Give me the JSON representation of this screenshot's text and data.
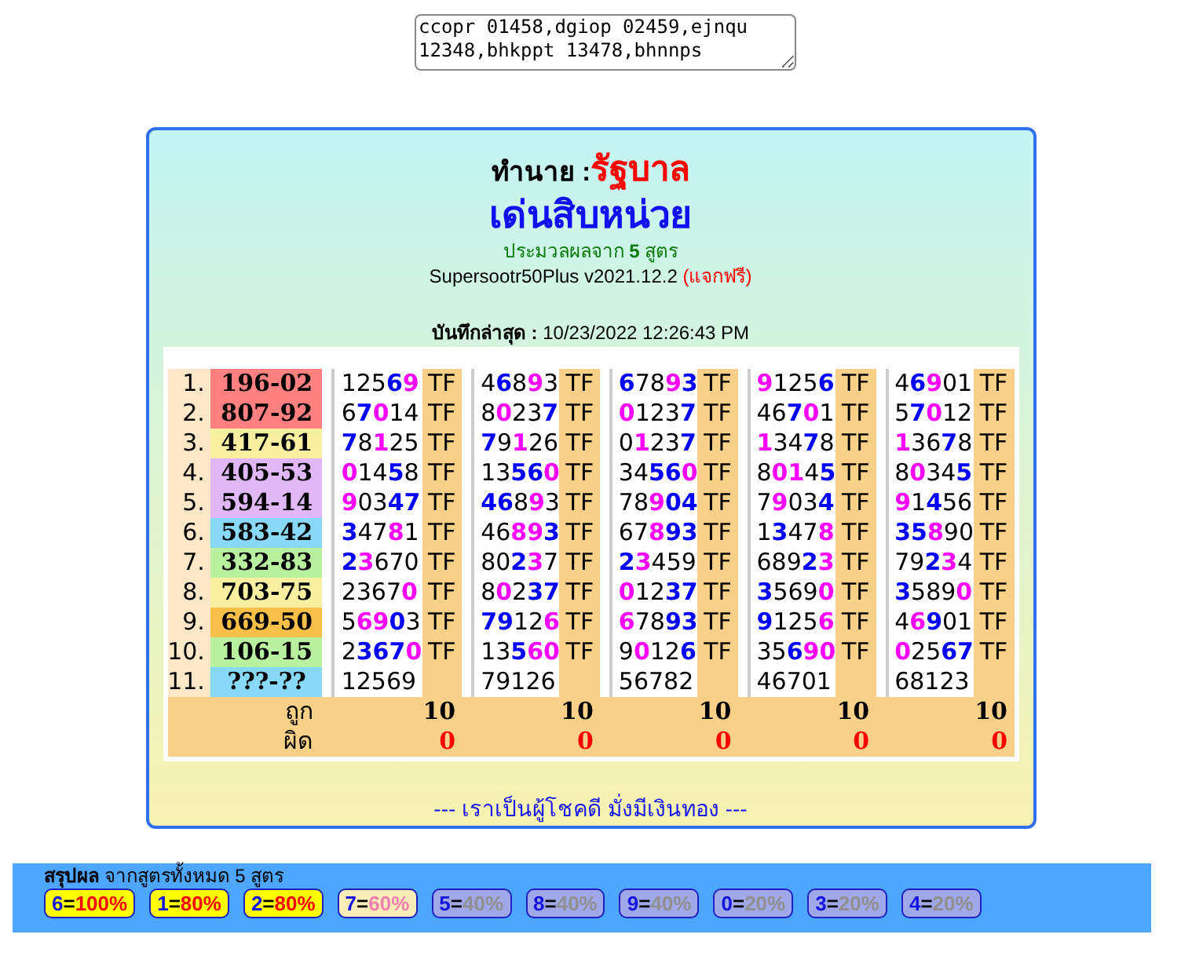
{
  "input_box": {
    "value": "ccopr 01458,dgiop 02459,ejnqu 12348,bhkppt 13478,bhnnps"
  },
  "header": {
    "predict_label": "ทำนาย : ",
    "predict_value": "รัฐบาล",
    "title": "เด่นสิบหน่วย",
    "subtitle": "ประมวลผลจาก **5** สูตร",
    "version": "Supersootr50Plus v2021.12.2 ",
    "free_tag": "(แจกฟรี)",
    "saved": "**บันทึกล่าสุด :** 10/23/2022 12:26:43 PM"
  },
  "table": {
    "rows": [
      {
        "index": "1.",
        "result": "196-02",
        "color": "#ff8080",
        "cells": [
          {
            "parts": [
              {
                "text": "125",
                "color": "#000000"
              },
              {
                "text": "6",
                "color": "#0000ff"
              },
              {
                "text": "9",
                "color": "#ff00ff"
              }
            ],
            "tag": "TF"
          },
          {
            "parts": [
              {
                "text": "4",
                "color": "#000000"
              },
              {
                "text": "6",
                "color": "#0000ff"
              },
              {
                "text": "8",
                "color": "#000000"
              },
              {
                "text": "9",
                "color": "#ff00ff"
              },
              {
                "text": "3",
                "color": "#000000"
              }
            ],
            "tag": "TF"
          },
          {
            "parts": [
              {
                "text": "6",
                "color": "#0000ff"
              },
              {
                "text": "78",
                "color": "#000000"
              },
              {
                "text": "9",
                "color": "#ff00ff"
              },
              {
                "text": "3",
                "color": "#0000ff"
              }
            ],
            "tag": "TF"
          },
          {
            "parts": [
              {
                "text": "9",
                "color": "#ff00ff"
              },
              {
                "text": "125",
                "color": "#000000"
              },
              {
                "text": "6",
                "color": "#0000ff"
              }
            ],
            "tag": "TF"
          },
          {
            "parts": [
              {
                "text": "4",
                "color": "#000000"
              },
              {
                "text": "6",
                "color": "#0000ff"
              },
              {
                "text": "9",
                "color": "#ff00ff"
              },
              {
                "text": "01",
                "color": "#000000"
              }
            ],
            "tag": "TF"
          }
        ]
      },
      {
        "index": "2.",
        "result": "807-92",
        "color": "#ff8080",
        "cells": [
          {
            "parts": [
              {
                "text": "6",
                "color": "#000000"
              },
              {
                "text": "7",
                "color": "#0000ff"
              },
              {
                "text": "0",
                "color": "#ff00ff"
              },
              {
                "text": "14",
                "color": "#000000"
              }
            ],
            "tag": "TF"
          },
          {
            "parts": [
              {
                "text": "8",
                "color": "#000000"
              },
              {
                "text": "0",
                "color": "#ff00ff"
              },
              {
                "text": "23",
                "color": "#000000"
              },
              {
                "text": "7",
                "color": "#0000ff"
              }
            ],
            "tag": "TF"
          },
          {
            "parts": [
              {
                "text": "0",
                "color": "#ff00ff"
              },
              {
                "text": "123",
                "color": "#000000"
              },
              {
                "text": "7",
                "color": "#0000ff"
              }
            ],
            "tag": "TF"
          },
          {
            "parts": [
              {
                "text": "46",
                "color": "#000000"
              },
              {
                "text": "7",
                "color": "#0000ff"
              },
              {
                "text": "0",
                "color": "#ff00ff"
              },
              {
                "text": "1",
                "color": "#000000"
              }
            ],
            "tag": "TF"
          },
          {
            "parts": [
              {
                "text": "5",
                "color": "#000000"
              },
              {
                "text": "7",
                "color": "#0000ff"
              },
              {
                "text": "0",
                "color": "#ff00ff"
              },
              {
                "text": "12",
                "color": "#000000"
              }
            ],
            "tag": "TF"
          }
        ]
      },
      {
        "index": "3.",
        "result": "417-61",
        "color": "#f8f0a0",
        "cells": [
          {
            "parts": [
              {
                "text": "7",
                "color": "#0000ff"
              },
              {
                "text": "8",
                "color": "#000000"
              },
              {
                "text": "1",
                "color": "#ff00ff"
              },
              {
                "text": "25",
                "color": "#000000"
              }
            ],
            "tag": "TF"
          },
          {
            "parts": [
              {
                "text": "7",
                "color": "#0000ff"
              },
              {
                "text": "9",
                "color": "#000000"
              },
              {
                "text": "1",
                "color": "#ff00ff"
              },
              {
                "text": "26",
                "color": "#000000"
              }
            ],
            "tag": "TF"
          },
          {
            "parts": [
              {
                "text": "0",
                "color": "#000000"
              },
              {
                "text": "1",
                "color": "#ff00ff"
              },
              {
                "text": "23",
                "color": "#000000"
              },
              {
                "text": "7",
                "color": "#0000ff"
              }
            ],
            "tag": "TF"
          },
          {
            "parts": [
              {
                "text": "1",
                "color": "#ff00ff"
              },
              {
                "text": "34",
                "color": "#000000"
              },
              {
                "text": "7",
                "color": "#0000ff"
              },
              {
                "text": "8",
                "color": "#000000"
              }
            ],
            "tag": "TF"
          },
          {
            "parts": [
              {
                "text": "1",
                "color": "#ff00ff"
              },
              {
                "text": "36",
                "color": "#000000"
              },
              {
                "text": "7",
                "color": "#0000ff"
              },
              {
                "text": "8",
                "color": "#000000"
              }
            ],
            "tag": "TF"
          }
        ]
      },
      {
        "index": "4.",
        "result": "405-53",
        "color": "#e0b8f8",
        "cells": [
          {
            "parts": [
              {
                "text": "0",
                "color": "#ff00ff"
              },
              {
                "text": "14",
                "color": "#000000"
              },
              {
                "text": "5",
                "color": "#0000ff"
              },
              {
                "text": "8",
                "color": "#000000"
              }
            ],
            "tag": "TF"
          },
          {
            "parts": [
              {
                "text": "13",
                "color": "#000000"
              },
              {
                "text": "56",
                "color": "#0000ff"
              },
              {
                "text": "0",
                "color": "#ff00ff"
              }
            ],
            "tag": "TF"
          },
          {
            "parts": [
              {
                "text": "34",
                "color": "#000000"
              },
              {
                "text": "56",
                "color": "#0000ff"
              },
              {
                "text": "0",
                "color": "#ff00ff"
              }
            ],
            "tag": "TF"
          },
          {
            "parts": [
              {
                "text": "8",
                "color": "#000000"
              },
              {
                "text": "01",
                "color": "#ff00ff"
              },
              {
                "text": "4",
                "color": "#000000"
              },
              {
                "text": "5",
                "color": "#0000ff"
              }
            ],
            "tag": "TF"
          },
          {
            "parts": [
              {
                "text": "8",
                "color": "#000000"
              },
              {
                "text": "0",
                "color": "#ff00ff"
              },
              {
                "text": "34",
                "color": "#000000"
              },
              {
                "text": "5",
                "color": "#0000ff"
              }
            ],
            "tag": "TF"
          }
        ]
      },
      {
        "index": "5.",
        "result": "594-14",
        "color": "#e0b8f8",
        "cells": [
          {
            "parts": [
              {
                "text": "9",
                "color": "#ff00ff"
              },
              {
                "text": "03",
                "color": "#000000"
              },
              {
                "text": "47",
                "color": "#0000ff"
              }
            ],
            "tag": "TF"
          },
          {
            "parts": [
              {
                "text": "46",
                "color": "#0000ff"
              },
              {
                "text": "8",
                "color": "#000000"
              },
              {
                "text": "9",
                "color": "#ff00ff"
              },
              {
                "text": "3",
                "color": "#000000"
              }
            ],
            "tag": "TF"
          },
          {
            "parts": [
              {
                "text": "78",
                "color": "#000000"
              },
              {
                "text": "9",
                "color": "#ff00ff"
              },
              {
                "text": "04",
                "color": "#0000ff"
              }
            ],
            "tag": "TF"
          },
          {
            "parts": [
              {
                "text": "7",
                "color": "#000000"
              },
              {
                "text": "9",
                "color": "#ff00ff"
              },
              {
                "text": "03",
                "color": "#000000"
              },
              {
                "text": "4",
                "color": "#0000ff"
              }
            ],
            "tag": "TF"
          },
          {
            "parts": [
              {
                "text": "9",
                "color": "#ff00ff"
              },
              {
                "text": "1",
                "color": "#000000"
              },
              {
                "text": "4",
                "color": "#0000ff"
              },
              {
                "text": "56",
                "color": "#000000"
              }
            ],
            "tag": "TF"
          }
        ]
      },
      {
        "index": "6.",
        "result": "583-42",
        "color": "#88d8f8",
        "cells": [
          {
            "parts": [
              {
                "text": "3",
                "color": "#0000ff"
              },
              {
                "text": "47",
                "color": "#000000"
              },
              {
                "text": "8",
                "color": "#ff00ff"
              },
              {
                "text": "1",
                "color": "#000000"
              }
            ],
            "tag": "TF"
          },
          {
            "parts": [
              {
                "text": "46",
                "color": "#000000"
              },
              {
                "text": "89",
                "color": "#ff00ff"
              },
              {
                "text": "3",
                "color": "#0000ff"
              }
            ],
            "tag": "TF"
          },
          {
            "parts": [
              {
                "text": "67",
                "color": "#000000"
              },
              {
                "text": "8",
                "color": "#ff00ff"
              },
              {
                "text": "93",
                "color": "#0000ff"
              }
            ],
            "tag": "TF"
          },
          {
            "parts": [
              {
                "text": "1",
                "color": "#000000"
              },
              {
                "text": "3",
                "color": "#0000ff"
              },
              {
                "text": "47",
                "color": "#000000"
              },
              {
                "text": "8",
                "color": "#ff00ff"
              }
            ],
            "tag": "TF"
          },
          {
            "parts": [
              {
                "text": "35",
                "color": "#0000ff"
              },
              {
                "text": "8",
                "color": "#ff00ff"
              },
              {
                "text": "90",
                "color": "#000000"
              }
            ],
            "tag": "TF"
          }
        ]
      },
      {
        "index": "7.",
        "result": "332-83",
        "color": "#b8f0a0",
        "cells": [
          {
            "parts": [
              {
                "text": "2",
                "color": "#0000ff"
              },
              {
                "text": "3",
                "color": "#ff00ff"
              },
              {
                "text": "670",
                "color": "#000000"
              }
            ],
            "tag": "TF"
          },
          {
            "parts": [
              {
                "text": "80",
                "color": "#000000"
              },
              {
                "text": "2",
                "color": "#0000ff"
              },
              {
                "text": "3",
                "color": "#ff00ff"
              },
              {
                "text": "7",
                "color": "#000000"
              }
            ],
            "tag": "TF"
          },
          {
            "parts": [
              {
                "text": "2",
                "color": "#0000ff"
              },
              {
                "text": "3",
                "color": "#ff00ff"
              },
              {
                "text": "459",
                "color": "#000000"
              }
            ],
            "tag": "TF"
          },
          {
            "parts": [
              {
                "text": "689",
                "color": "#000000"
              },
              {
                "text": "2",
                "color": "#0000ff"
              },
              {
                "text": "3",
                "color": "#ff00ff"
              }
            ],
            "tag": "TF"
          },
          {
            "parts": [
              {
                "text": "79",
                "color": "#000000"
              },
              {
                "text": "2",
                "color": "#0000ff"
              },
              {
                "text": "3",
                "color": "#ff00ff"
              },
              {
                "text": "4",
                "color": "#000000"
              }
            ],
            "tag": "TF"
          }
        ]
      },
      {
        "index": "8.",
        "result": "703-75",
        "color": "#f8f0a0",
        "cells": [
          {
            "parts": [
              {
                "text": "2367",
                "color": "#000000"
              },
              {
                "text": "0",
                "color": "#ff00ff"
              }
            ],
            "tag": "TF"
          },
          {
            "parts": [
              {
                "text": "8",
                "color": "#000000"
              },
              {
                "text": "0",
                "color": "#ff00ff"
              },
              {
                "text": "2",
                "color": "#000000"
              },
              {
                "text": "37",
                "color": "#0000ff"
              }
            ],
            "tag": "TF"
          },
          {
            "parts": [
              {
                "text": "0",
                "color": "#ff00ff"
              },
              {
                "text": "12",
                "color": "#000000"
              },
              {
                "text": "37",
                "color": "#0000ff"
              }
            ],
            "tag": "TF"
          },
          {
            "parts": [
              {
                "text": "3",
                "color": "#0000ff"
              },
              {
                "text": "569",
                "color": "#000000"
              },
              {
                "text": "0",
                "color": "#ff00ff"
              }
            ],
            "tag": "TF"
          },
          {
            "parts": [
              {
                "text": "3",
                "color": "#0000ff"
              },
              {
                "text": "589",
                "color": "#000000"
              },
              {
                "text": "0",
                "color": "#ff00ff"
              }
            ],
            "tag": "TF"
          }
        ]
      },
      {
        "index": "9.",
        "result": "669-50",
        "color": "#f8c048",
        "cells": [
          {
            "parts": [
              {
                "text": "5",
                "color": "#000000"
              },
              {
                "text": "69",
                "color": "#ff00ff"
              },
              {
                "text": "0",
                "color": "#0000ff"
              },
              {
                "text": "3",
                "color": "#000000"
              }
            ],
            "tag": "TF"
          },
          {
            "parts": [
              {
                "text": "79",
                "color": "#0000ff"
              },
              {
                "text": "12",
                "color": "#000000"
              },
              {
                "text": "6",
                "color": "#ff00ff"
              }
            ],
            "tag": "TF"
          },
          {
            "parts": [
              {
                "text": "6",
                "color": "#ff00ff"
              },
              {
                "text": "78",
                "color": "#000000"
              },
              {
                "text": "93",
                "color": "#0000ff"
              }
            ],
            "tag": "TF"
          },
          {
            "parts": [
              {
                "text": "9",
                "color": "#0000ff"
              },
              {
                "text": "125",
                "color": "#000000"
              },
              {
                "text": "6",
                "color": "#ff00ff"
              }
            ],
            "tag": "TF"
          },
          {
            "parts": [
              {
                "text": "4",
                "color": "#000000"
              },
              {
                "text": "6",
                "color": "#ff00ff"
              },
              {
                "text": "9",
                "color": "#0000ff"
              },
              {
                "text": "01",
                "color": "#000000"
              }
            ],
            "tag": "TF"
          }
        ]
      },
      {
        "index": "10.",
        "result": "106-15",
        "color": "#b8f0a0",
        "cells": [
          {
            "parts": [
              {
                "text": "2",
                "color": "#000000"
              },
              {
                "text": "367",
                "color": "#0000ff"
              },
              {
                "text": "0",
                "color": "#ff00ff"
              }
            ],
            "tag": "TF"
          },
          {
            "parts": [
              {
                "text": "13",
                "color": "#000000"
              },
              {
                "text": "5",
                "color": "#0000ff"
              },
              {
                "text": "60",
                "color": "#ff00ff"
              }
            ],
            "tag": "TF"
          },
          {
            "parts": [
              {
                "text": "9",
                "color": "#000000"
              },
              {
                "text": "0",
                "color": "#ff00ff"
              },
              {
                "text": "12",
                "color": "#000000"
              },
              {
                "text": "6",
                "color": "#0000ff"
              }
            ],
            "tag": "TF"
          },
          {
            "parts": [
              {
                "text": "35",
                "color": "#000000"
              },
              {
                "text": "6",
                "color": "#0000ff"
              },
              {
                "text": "90",
                "color": "#ff00ff"
              }
            ],
            "tag": "TF"
          },
          {
            "parts": [
              {
                "text": "0",
                "color": "#ff00ff"
              },
              {
                "text": "25",
                "color": "#000000"
              },
              {
                "text": "67",
                "color": "#0000ff"
              }
            ],
            "tag": "TF"
          }
        ]
      },
      {
        "index": "11.",
        "result": "???-??",
        "color": "#88d8f8",
        "cells": [
          {
            "parts": [
              {
                "text": "12569",
                "color": "#000000"
              }
            ]
          },
          {
            "parts": [
              {
                "text": "79126",
                "color": "#000000"
              }
            ]
          },
          {
            "parts": [
              {
                "text": "56782",
                "color": "#000000"
              }
            ]
          },
          {
            "parts": [
              {
                "text": "46701",
                "color": "#000000"
              }
            ]
          },
          {
            "parts": [
              {
                "text": "68123",
                "color": "#000000"
              }
            ]
          }
        ]
      }
    ],
    "correct": {
      "label": "ถูก",
      "values": [
        "10",
        "10",
        "10",
        "10",
        "10"
      ]
    },
    "wrong": {
      "label": "ผิด",
      "values": [
        "0",
        "0",
        "0",
        "0",
        "0"
      ]
    }
  },
  "motto": "--- เราเป็นผู้โชคดี มั่งมีเงินทอง ---",
  "summary": {
    "title": "**สรุปผล** จากสูตรทั้งหมด 5 สูตร",
    "badges": [
      {
        "digit": "6",
        "sign": "=",
        "percent": "100%",
        "kind": "high"
      },
      {
        "digit": "1",
        "sign": "=",
        "percent": "80%",
        "kind": "high"
      },
      {
        "digit": "2",
        "sign": "=",
        "percent": "80%",
        "kind": "high"
      },
      {
        "digit": "7",
        "sign": "=",
        "percent": "60%",
        "kind": "mid"
      },
      {
        "digit": "5",
        "sign": "=",
        "percent": "40%",
        "kind": "low"
      },
      {
        "digit": "8",
        "sign": "=",
        "percent": "40%",
        "kind": "low"
      },
      {
        "digit": "9",
        "sign": "=",
        "percent": "40%",
        "kind": "low"
      },
      {
        "digit": "0",
        "sign": "=",
        "percent": "20%",
        "kind": "low"
      },
      {
        "digit": "3",
        "sign": "=",
        "percent": "20%",
        "kind": "low"
      },
      {
        "digit": "4",
        "sign": "=",
        "percent": "20%",
        "kind": "low"
      }
    ]
  }
}
